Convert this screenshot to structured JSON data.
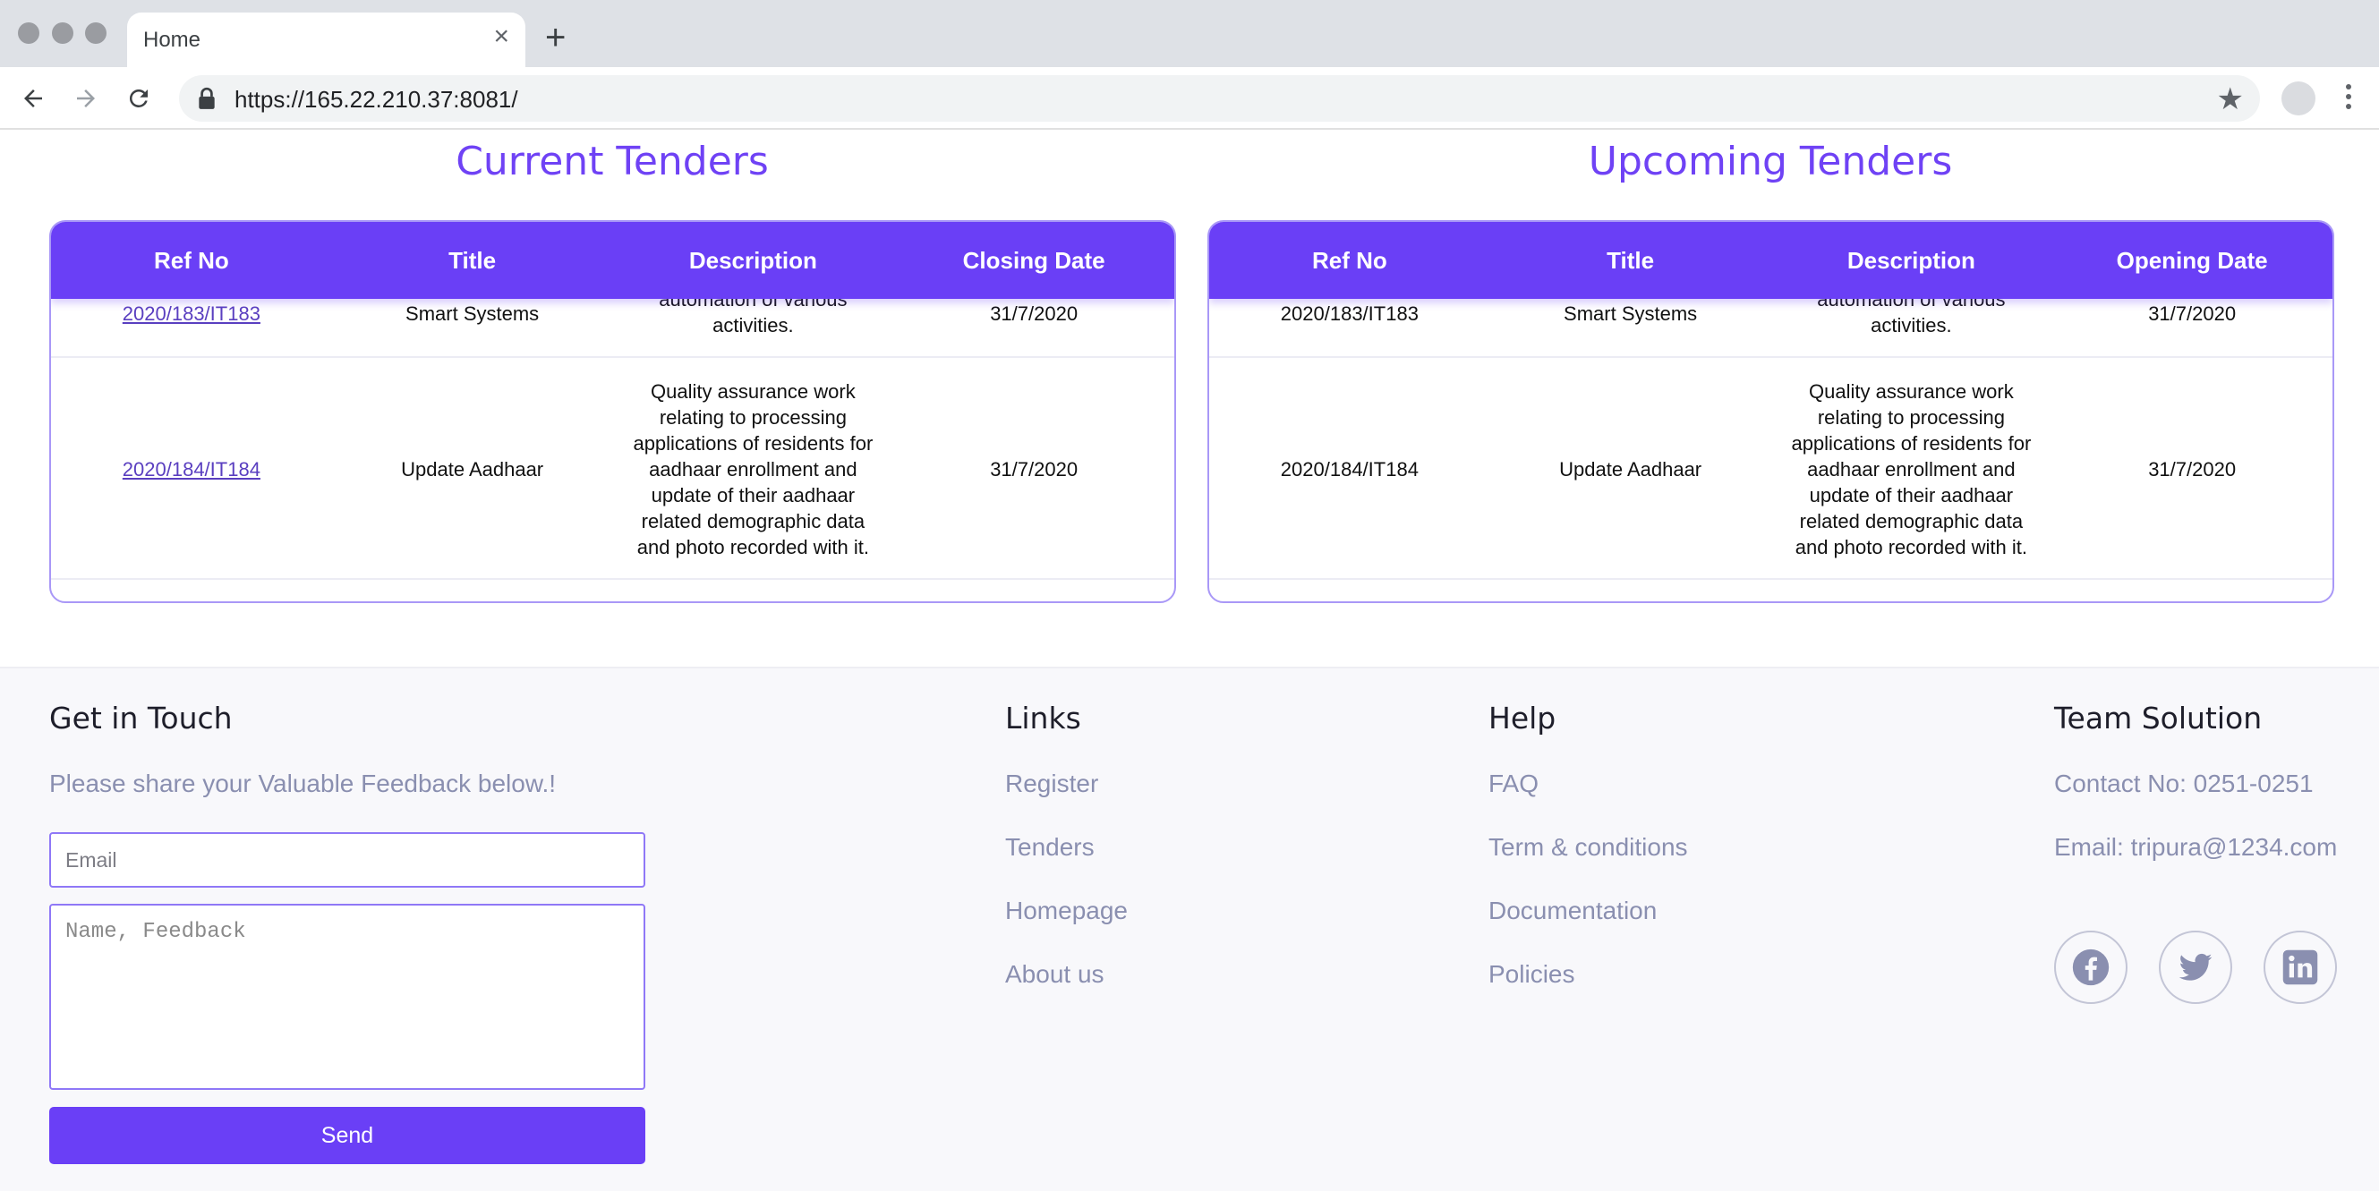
{
  "browser": {
    "tab_title": "Home",
    "tab_close": "×",
    "new_tab": "+",
    "url": "https://165.22.210.37:8081/"
  },
  "current_tenders": {
    "title": "Current Tenders",
    "columns": [
      "Ref No",
      "Title",
      "Description",
      "Closing Date"
    ],
    "partial_row": {
      "ref": "2020/183/IT183",
      "title": "Smart Systems",
      "description": "automation of various activities.",
      "date": "31/7/2020"
    },
    "rows": [
      {
        "ref": "2020/184/IT184",
        "title": "Update Aadhaar",
        "description": "Quality assurance work relating to processing applications of residents for aadhaar enrollment and update of their aadhaar related demographic data and photo recorded with it.",
        "date": "31/7/2020"
      }
    ]
  },
  "upcoming_tenders": {
    "title": "Upcoming Tenders",
    "columns": [
      "Ref No",
      "Title",
      "Description",
      "Opening Date"
    ],
    "partial_row": {
      "ref": "2020/183/IT183",
      "title": "Smart Systems",
      "description": "automation of various activities.",
      "date": "31/7/2020"
    },
    "rows": [
      {
        "ref": "2020/184/IT184",
        "title": "Update Aadhaar",
        "description": "Quality assurance work relating to processing applications of residents for aadhaar enrollment and update of their aadhaar related demographic data and photo recorded with it.",
        "date": "31/7/2020"
      }
    ]
  },
  "footer": {
    "get_in_touch": {
      "heading": "Get in Touch",
      "subtitle": "Please share your Valuable Feedback below.!",
      "email_placeholder": "Email",
      "feedback_placeholder": "Name, Feedback",
      "send_label": "Send"
    },
    "links": {
      "heading": "Links",
      "items": [
        "Register",
        "Tenders",
        "Homepage",
        "About us"
      ]
    },
    "help": {
      "heading": "Help",
      "items": [
        "FAQ",
        "Term & conditions",
        "Documentation",
        "Policies"
      ]
    },
    "team": {
      "heading": "Team Solution",
      "contact": "Contact No: 0251-0251",
      "email": "Email: tripura@1234.com",
      "social_icons": [
        "facebook-icon",
        "twitter-icon",
        "linkedin-icon"
      ]
    }
  },
  "colors": {
    "accent": "#6a3ff6",
    "heading_purple": "#6f42f5",
    "muted_text": "#8a8fb0",
    "footer_bg": "#f8f8fb"
  }
}
